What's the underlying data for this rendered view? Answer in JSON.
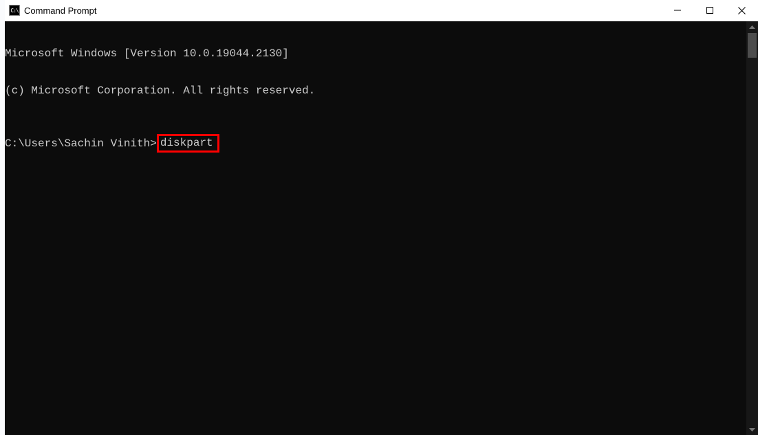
{
  "window": {
    "title": "Command Prompt",
    "icon_text": "C:\\"
  },
  "terminal": {
    "line1": "Microsoft Windows [Version 10.0.19044.2130]",
    "line2": "(c) Microsoft Corporation. All rights reserved.",
    "prompt": "C:\\Users\\Sachin Vinith>",
    "command": "diskpart"
  }
}
